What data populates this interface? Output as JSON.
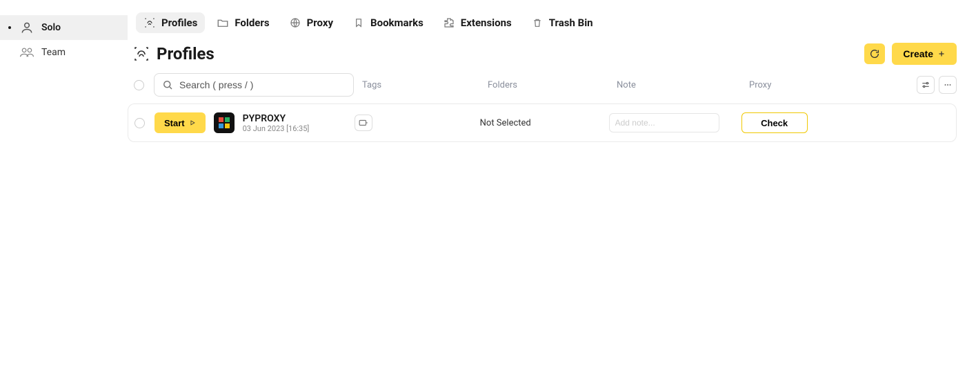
{
  "sidebar": {
    "items": [
      {
        "label": "Solo",
        "active": true
      },
      {
        "label": "Team",
        "active": false
      }
    ]
  },
  "topnav": {
    "items": [
      {
        "label": "Profiles",
        "icon": "fingerprint",
        "active": true
      },
      {
        "label": "Folders",
        "icon": "folder",
        "active": false
      },
      {
        "label": "Proxy",
        "icon": "globe",
        "active": false
      },
      {
        "label": "Bookmarks",
        "icon": "bookmark",
        "active": false
      },
      {
        "label": "Extensions",
        "icon": "puzzle",
        "active": false
      },
      {
        "label": "Trash Bin",
        "icon": "trash",
        "active": false
      }
    ]
  },
  "page": {
    "title": "Profiles"
  },
  "actions": {
    "create_label": "Create"
  },
  "search": {
    "placeholder": "Search ( press / )"
  },
  "columns": {
    "tags": "Tags",
    "folders": "Folders",
    "note": "Note",
    "proxy": "Proxy"
  },
  "profiles": [
    {
      "start_label": "Start",
      "name": "PYPROXY",
      "date": "03 Jun 2023 [16:35]",
      "folder": "Not Selected",
      "note_placeholder": "Add note...",
      "check_label": "Check",
      "icon_colors": [
        "#e74c3c",
        "#27ae60",
        "#3498db",
        "#f1c40f"
      ]
    }
  ]
}
